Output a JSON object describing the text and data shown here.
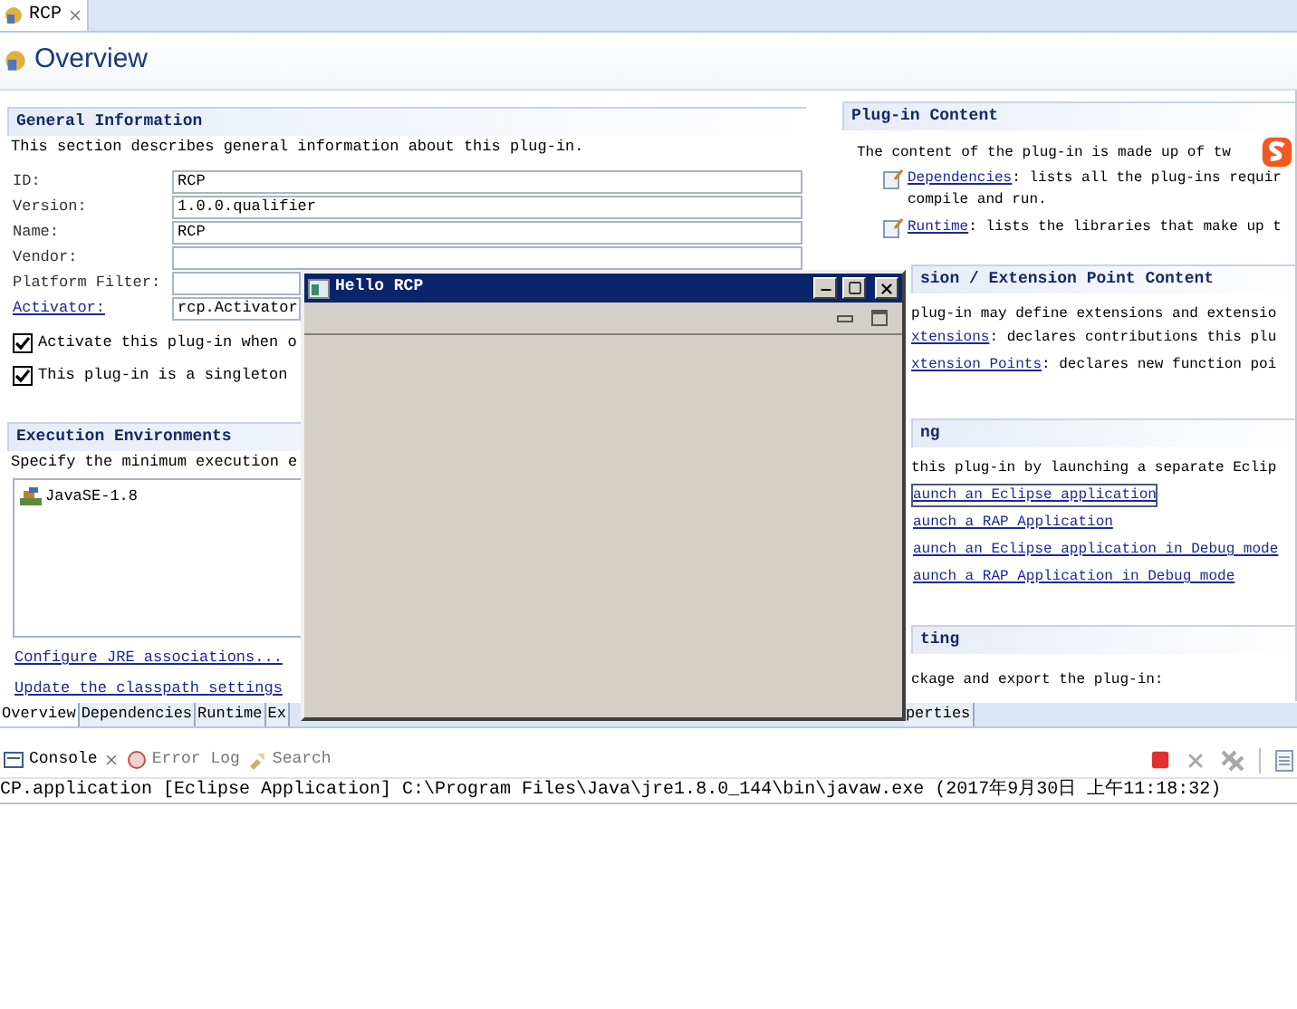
{
  "editor_tab": {
    "label": "RCP"
  },
  "page_title": "Overview",
  "general_information": {
    "title": "General Information",
    "description": "This section describes general information about this plug-in.",
    "fields": [
      {
        "kind": "text",
        "label": "ID:",
        "value": "RCP"
      },
      {
        "kind": "text",
        "label": "Version:",
        "value": "1.0.0.qualifier"
      },
      {
        "kind": "text",
        "label": "Name:",
        "value": "RCP"
      },
      {
        "kind": "text",
        "label": "Vendor:"
      },
      {
        "kind": "short",
        "label": "Platform Filter:"
      },
      {
        "kind": "link",
        "label": "Activator:",
        "value": "rcp.Activator"
      }
    ],
    "checkboxes": [
      {
        "label": "Activate this plug-in when o",
        "checked": true
      },
      {
        "label": "This plug-in is a singleton",
        "checked": true
      }
    ]
  },
  "execution_environments": {
    "title": "Execution Environments",
    "description": "Specify the minimum execution e",
    "items": [
      "JavaSE-1.8"
    ],
    "links": [
      "Configure JRE associations...",
      "Update the classpath settings"
    ]
  },
  "plugin_content": {
    "title": "Plug-in Content",
    "intro": "The content of the plug-in is made up of tw",
    "items": [
      {
        "link": "Dependencies",
        "text": ": lists all the plug-ins requir",
        "continuation": "compile and run."
      },
      {
        "link": "Runtime",
        "text": ": lists the libraries that make up t"
      }
    ]
  },
  "extension_content": {
    "title": "sion / Extension Point Content",
    "intro": "plug-in may define extensions and extensio",
    "items": [
      {
        "link": "xtensions",
        "text": ": declares contributions this plu"
      },
      {
        "link": "xtension Points",
        "text": ": declares new function poi"
      }
    ]
  },
  "testing": {
    "title": "ng",
    "intro": "this plug-in by launching a separate Eclip",
    "links": [
      {
        "label": "aunch an Eclipse application",
        "focused": true
      },
      {
        "label": "aunch a RAP Application",
        "focused": false
      },
      {
        "label": "aunch an Eclipse application in Debug mode",
        "focused": false
      },
      {
        "label": "aunch a RAP Application in Debug mode",
        "focused": false
      }
    ]
  },
  "exporting": {
    "title": "ting",
    "intro": "ckage and export the plug-in:"
  },
  "page_tabs": [
    {
      "label": "Overview",
      "selected": true
    },
    {
      "label": "Dependencies",
      "selected": false
    },
    {
      "label": "Runtime",
      "selected": false
    },
    {
      "label": "Ex",
      "selected": false
    }
  ],
  "page_tabs_right": [
    {
      "label": "perties",
      "selected": false
    }
  ],
  "floating_window": {
    "title": "Hello RCP"
  },
  "console": {
    "tabs": [
      {
        "label": "Console",
        "selected": true
      },
      {
        "label": "Error Log",
        "selected": false
      },
      {
        "label": "Search",
        "selected": false
      }
    ],
    "line": "CP.application [Eclipse Application] C:\\Program Files\\Java\\jre1.8.0_144\\bin\\javaw.exe (2017年9月30日 上午11:18:32)"
  }
}
